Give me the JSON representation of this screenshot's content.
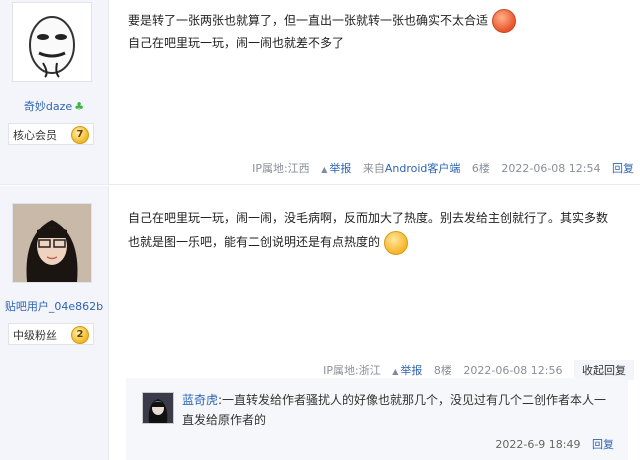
{
  "posts": [
    {
      "username": "奇妙daze",
      "badge": {
        "name": "核心会员",
        "level": "7"
      },
      "content": [
        "要是转了一张两张也就算了，但一直出一张就转一张也确实不太合适",
        "自己在吧里玩一玩，闹一闹也就差不多了"
      ],
      "emoji": "angry-face-icon",
      "meta": {
        "ip": "IP属地:江西",
        "report": "举报",
        "client_prefix": "来自",
        "client_name": "Android客户端",
        "floor": "6楼",
        "time": "2022-06-08 12:54",
        "reply": "回复"
      }
    },
    {
      "username": "贴吧用户_04e862b",
      "badge": {
        "name": "中级粉丝",
        "level": "2"
      },
      "content": [
        "自己在吧里玩一玩，闹一闹，没毛病啊，反而加大了热度。别去发给主创就行了。其实多数",
        "也就是图一乐吧，能有二创说明还是有点热度的"
      ],
      "emoji": "tongue-face-icon",
      "meta": {
        "ip": "IP属地:浙江",
        "report": "举报",
        "floor": "8楼",
        "time": "2022-06-08 12:56",
        "collapse": "收起回复"
      },
      "lzl": {
        "user": "蓝奇虎",
        "text": ":一直转发给作者骚扰人的好像也就那几个，没见过有几个二创作者本人一直发给原作者的",
        "time": "2022-6-9 18:49",
        "reply": "回复"
      }
    }
  ]
}
